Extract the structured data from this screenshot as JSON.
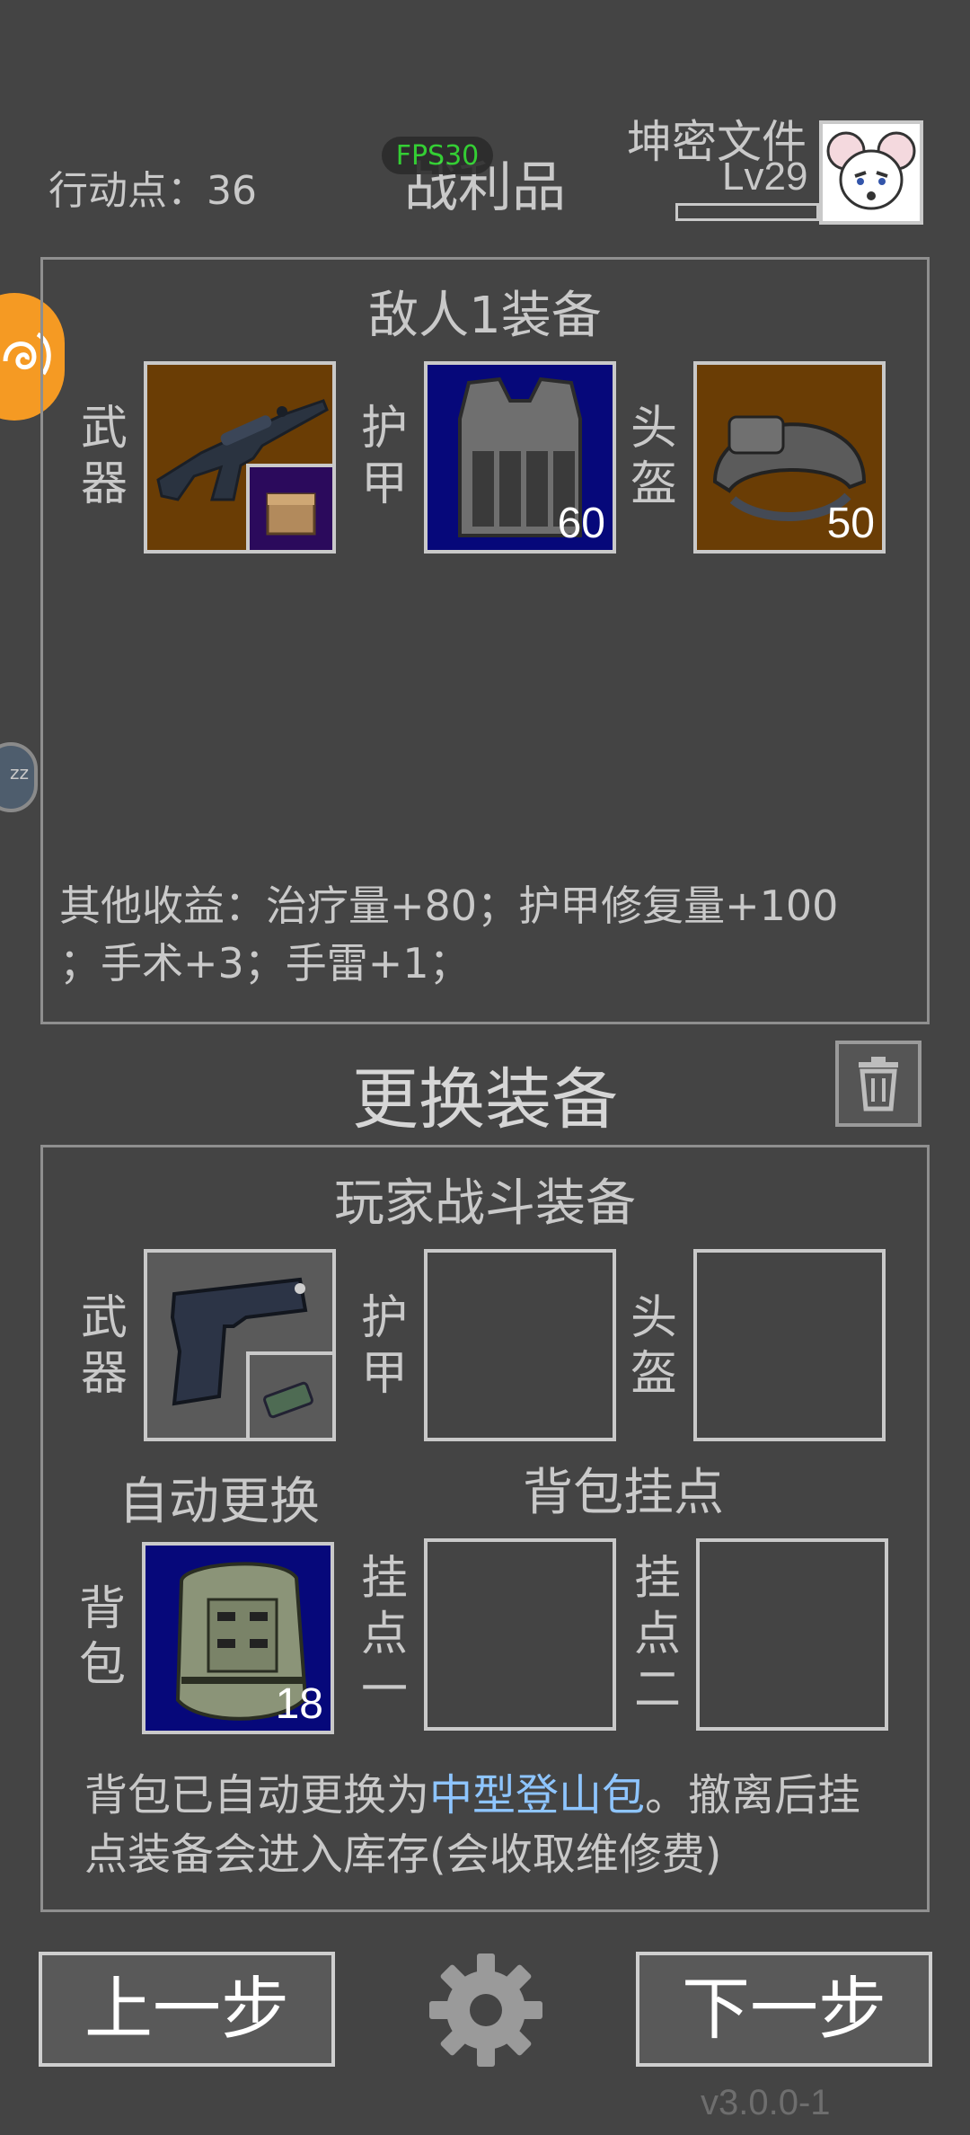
{
  "header": {
    "action_points": "行动点：36",
    "title": "战利品",
    "fps": "FPS30",
    "player_name": "坤密文件",
    "level": "Lv29",
    "level_progress": 0
  },
  "enemy_panel": {
    "title": "敌人1装备",
    "weapon_label": "武器",
    "armor_label": "护甲",
    "helmet_label": "头盔",
    "armor_value": "60",
    "helmet_value": "50",
    "other_gains_line1": "其他收益：治疗量+80；护甲修复量+100",
    "other_gains_line2": "；手术+3；手雷+1；"
  },
  "change_section": {
    "title": "更换装备"
  },
  "player_panel": {
    "title": "玩家战斗装备",
    "weapon_label": "武器",
    "armor_label": "护甲",
    "helmet_label": "头盔",
    "auto_replace": "自动更换",
    "backpack_mounts": "背包挂点",
    "backpack_label": "背包",
    "backpack_value": "18",
    "mount1_label": "挂点一",
    "mount2_label": "挂点二",
    "notice_pre": "背包已自动更换为",
    "notice_highlight": "中型登山包",
    "notice_post": "。撤离后挂",
    "notice_line2": "点装备会进入库存(会收取维修费)"
  },
  "footer": {
    "prev": "上一步",
    "next": "下一步",
    "version": "v3.0.0-1"
  },
  "side": {
    "floating_badge": "zz"
  },
  "colors": {
    "background": "#444444",
    "highlight_text": "#8ec5ff",
    "fps_green": "#33dd33",
    "brown_slot": "#6a3d05",
    "navy_slot": "#06087a",
    "orange_bubble": "#f59a23"
  }
}
